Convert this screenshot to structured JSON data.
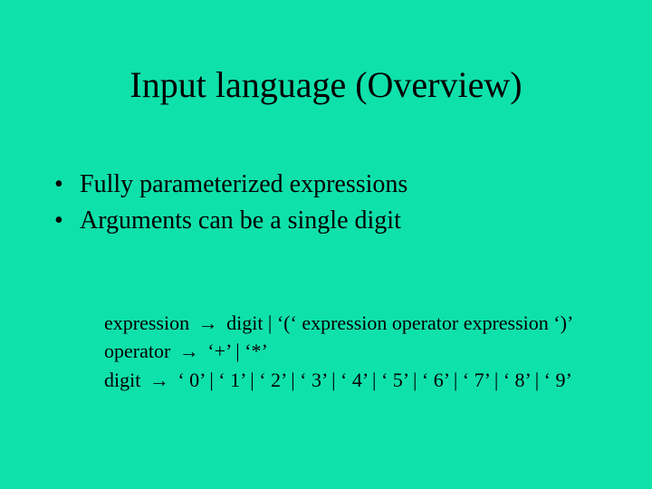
{
  "title": "Input language (Overview)",
  "bullets": [
    "Fully parameterized expressions",
    "Arguments can be a single digit"
  ],
  "grammar": {
    "arrow": "→",
    "rules": [
      {
        "lhs": "expression",
        "rhs": "digit | ‘(‘ expression operator expression ‘)’"
      },
      {
        "lhs": "operator",
        "rhs": "‘+’ | ‘*’"
      },
      {
        "lhs": "digit",
        "rhs": "‘ 0’ | ‘ 1’ | ‘ 2’ | ‘ 3’ | ‘ 4’ | ‘ 5’ | ‘ 6’ | ‘ 7’ | ‘ 8’ | ‘ 9’"
      }
    ]
  }
}
